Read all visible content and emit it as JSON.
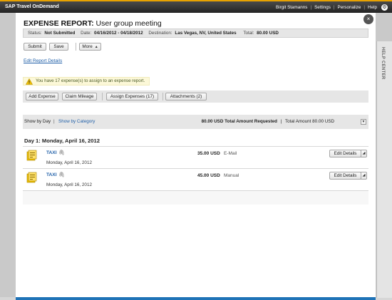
{
  "topbar": {
    "brand": "SAP Travel OnDemand",
    "user": "Birgit Stamanns",
    "settings": "Settings",
    "personalize": "Personalize",
    "help": "Help",
    "gear_icon": "gear-icon"
  },
  "help_center": {
    "label": "HELP CENTER"
  },
  "dialog": {
    "close_label": "×",
    "title_prefix": "EXPENSE REPORT:",
    "title_name": "User group meeting",
    "status": {
      "status_label": "Status:",
      "status_value": "Not Submitted",
      "date_label": "Date:",
      "date_value": "04/16/2012 - 04/18/2012",
      "destination_label": "Destination:",
      "destination_value": "Las Vegas, NV, United States",
      "total_label": "Total:",
      "total_value": "80.00 USD"
    },
    "actions": {
      "submit": "Submit",
      "save": "Save",
      "more": "More"
    },
    "edit_report_details": "Edit Report Details",
    "info_message": "You have 17 expense(s) to assign to an expense report.",
    "toolbar": {
      "add_expense": "Add Expense",
      "claim_mileage": "Claim Mileage",
      "assign_expenses": "Assign Expenses (17)",
      "attachments": "Attachments (2)"
    },
    "view_bar": {
      "show_by_day": "Show by Day",
      "separator": "|",
      "show_by_category": "Show by Category",
      "total_requested_amount": "80.00 USD",
      "total_requested_label": "Total Amount Requested",
      "separator2": "|",
      "total_amount": "Total Amount 80.00 USD"
    },
    "day_heading": "Day 1: Monday, April 16, 2012",
    "expenses": [
      {
        "name": "TAXI",
        "date": "Monday, April 16, 2012",
        "amount": "35.00 USD",
        "source": "E-Mail",
        "edit_label": "Edit Details"
      },
      {
        "name": "TAXI",
        "date": "Monday, April 16, 2012",
        "amount": "45.00 USD",
        "source": "Manual",
        "edit_label": "Edit Details"
      }
    ]
  },
  "colors": {
    "accent": "#e8a200",
    "link": "#1f5fa8",
    "bottom_bar": "#1f73b7"
  }
}
